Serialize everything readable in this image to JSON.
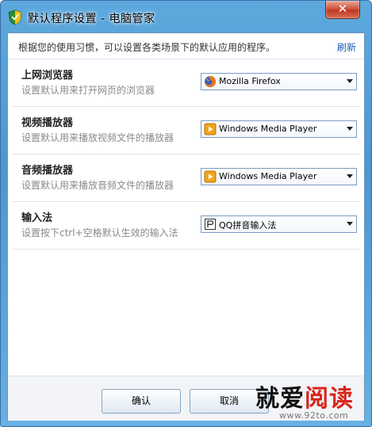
{
  "window": {
    "title": "默认程序设置 - 电脑管家",
    "close_label": "✕",
    "accent_color": "#5da9de",
    "close_color": "#c8452d"
  },
  "banner": {
    "text": "根据您的使用习惯，可以设置各类场景下的默认应用的程序。",
    "refresh_label": "刷新"
  },
  "rows": [
    {
      "title": "上网浏览器",
      "desc": "设置默认用来打开网页的浏览器",
      "selected": "Mozilla Firefox",
      "icon": "firefox-icon"
    },
    {
      "title": "视频播放器",
      "desc": "设置默认用来播放视频文件的播放器",
      "selected": "Windows Media Player",
      "icon": "media-player-icon"
    },
    {
      "title": "音频播放器",
      "desc": "设置默认用来播放音频文件的播放器",
      "selected": "Windows Media Player",
      "icon": "media-player-icon"
    },
    {
      "title": "输入法",
      "desc": "设置按下ctrl+空格默认生效的输入法",
      "selected": "QQ拼音输入法",
      "icon": "qq-pinyin-icon"
    }
  ],
  "footer": {
    "ok_label": "确认",
    "cancel_label": "取消"
  },
  "watermark": {
    "text": "就爱阅读",
    "url": "www.92to.com"
  }
}
